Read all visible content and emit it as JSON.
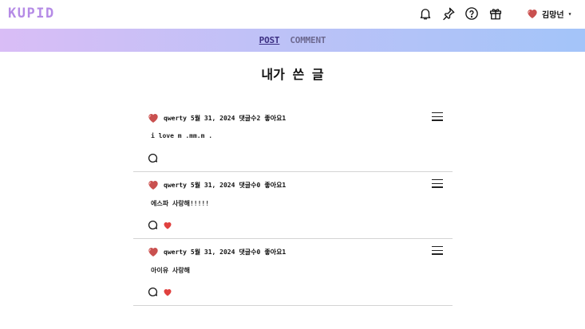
{
  "header": {
    "logo": "KUPID",
    "user_name": "김망넌",
    "caret": "▾"
  },
  "tabs": [
    {
      "label": "POST",
      "active": true
    },
    {
      "label": "COMMENT",
      "active": false
    }
  ],
  "page_title": "내가 쓴 글",
  "posts": [
    {
      "author": "qwerty",
      "date": "5월 31, 2024",
      "comments": "댓글수2",
      "likes": "좋아요1",
      "content": "i love m .mm.m .",
      "liked": false
    },
    {
      "author": "qwerty",
      "date": "5월 31, 2024",
      "comments": "댓글수0",
      "likes": "좋아요1",
      "content": "에스파 사랑해!!!!!",
      "liked": true
    },
    {
      "author": "qwerty",
      "date": "5월 31, 2024",
      "comments": "댓글수0",
      "likes": "좋아요1",
      "content": "아이유 사랑해",
      "liked": true
    }
  ],
  "colors": {
    "logo": "#b58be6",
    "heart": "#e0413f",
    "active_tab": "#3b2e82"
  }
}
